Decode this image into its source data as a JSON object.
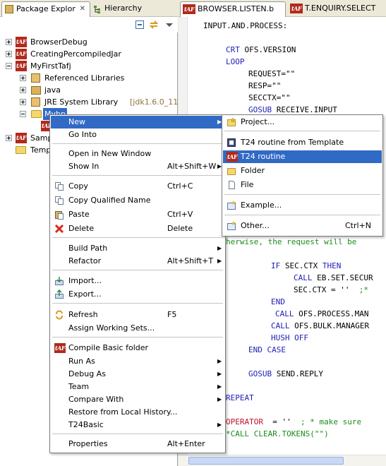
{
  "left_view": {
    "tabs": [
      {
        "label": "Package Explor",
        "active": true,
        "icon": "package-explorer-icon"
      },
      {
        "label": "Hierarchy",
        "active": false,
        "icon": "hierarchy-icon"
      }
    ],
    "toolbar_icons": [
      "collapse-all-icon",
      "link-with-editor-icon",
      "view-menu-icon"
    ],
    "tree": [
      {
        "label": "BrowserDebug",
        "icon": "taf-icon",
        "expanded": false
      },
      {
        "label": "CreatingPercompiledJar",
        "icon": "taf-icon",
        "expanded": false
      },
      {
        "label": "MyFirstTafj",
        "icon": "taf-icon",
        "expanded": true
      },
      {
        "label": "Referenced Libraries",
        "icon": "jar-icon",
        "expanded": false
      },
      {
        "label": "java",
        "icon": "package-root-icon",
        "expanded": false
      },
      {
        "label": "JRE System Library",
        "suffix": "[jdk1.6.0_11]",
        "icon": "jar-icon",
        "expanded": false
      },
      {
        "label": "Mybp",
        "icon": "folder-icon",
        "expanded": true,
        "selected": true
      },
      {
        "label": "Samp",
        "icon": "taf-icon",
        "expanded": false
      },
      {
        "label": "Temp",
        "icon": "folder-icon",
        "expanded": false
      }
    ]
  },
  "editor": {
    "tabs": [
      {
        "label": "BROWSER.LISTEN.b",
        "active": true
      },
      {
        "label": "T.ENQUIRY.SELECT",
        "active": false
      }
    ],
    "lines": {
      "l1": "INPUT.AND.PROCESS:",
      "l2_kw": "CRT",
      "l2_rest": " OFS.VERSION",
      "l3": "LOOP",
      "l4": "REQUEST=\"\"",
      "l5": "RESP=\"\"",
      "l6": "SECCTX=\"\"",
      "l7_kw": "GOSUB",
      "l7_rest": " RECEIVE.INPUT",
      "l8": "herwise, the request will be",
      "l9_kw1": "IF",
      "l9_mid": " SEC.CTX ",
      "l9_kw2": "THEN",
      "l10_kw": "CALL",
      "l10_rest": " EB.SET.SECUR",
      "l11": "SEC.CTX = ''",
      "l11_cm": "  ;*",
      "l12": "END",
      "l13_kw": "CALL",
      "l13_rest": " OFS.PROCESS.MAN",
      "l14_kw": "CALL",
      "l14_rest": " OFS.BULK.MANAGER",
      "l15_kw": "HUSH",
      "l15_rest": " OFF",
      "l16": "END CASE",
      "l17_kw": "GOSUB",
      "l17_rest": " SEND.REPLY",
      "l18": "REPEAT",
      "l19_op": "OPERATOR",
      "l19_rest": "  = ''",
      "l19_cm": "  ; * make sure",
      "l20": "*CALL CLEAR.TOKENS(\"\")"
    }
  },
  "context_menu": {
    "items": [
      {
        "label": "New",
        "submenu": true,
        "highlighted": true
      },
      {
        "label": "Go Into"
      },
      {
        "label": "Open in New Window"
      },
      {
        "label": "Show In",
        "shortcut": "Alt+Shift+W",
        "submenu": true
      },
      {
        "label": "Copy",
        "shortcut": "Ctrl+C",
        "icon": "copy-icon"
      },
      {
        "label": "Copy Qualified Name",
        "icon": "copy-icon"
      },
      {
        "label": "Paste",
        "shortcut": "Ctrl+V",
        "icon": "paste-icon"
      },
      {
        "label": "Delete",
        "shortcut": "Delete",
        "icon": "delete-icon"
      },
      {
        "label": "Build Path",
        "submenu": true
      },
      {
        "label": "Refactor",
        "shortcut": "Alt+Shift+T",
        "submenu": true
      },
      {
        "label": "Import...",
        "icon": "import-icon"
      },
      {
        "label": "Export...",
        "icon": "export-icon"
      },
      {
        "label": "Refresh",
        "shortcut": "F5",
        "icon": "refresh-icon"
      },
      {
        "label": "Assign Working Sets..."
      },
      {
        "label": "Compile Basic folder",
        "icon": "taf-icon"
      },
      {
        "label": "Run As",
        "submenu": true
      },
      {
        "label": "Debug As",
        "submenu": true
      },
      {
        "label": "Team",
        "submenu": true
      },
      {
        "label": "Compare With",
        "submenu": true
      },
      {
        "label": "Restore from Local History..."
      },
      {
        "label": "T24Basic",
        "submenu": true
      },
      {
        "label": "Properties",
        "shortcut": "Alt+Enter"
      }
    ]
  },
  "submenu": {
    "items": [
      {
        "label": "Project...",
        "icon": "new-project-icon"
      },
      {
        "label": "T24 routine from Template",
        "icon": "template-icon"
      },
      {
        "label": "T24 routine",
        "icon": "taf-icon",
        "highlighted": true
      },
      {
        "label": "Folder",
        "icon": "folder-icon"
      },
      {
        "label": "File",
        "icon": "file-icon"
      },
      {
        "label": "Example...",
        "icon": "example-icon"
      },
      {
        "label": "Other...",
        "shortcut": "Ctrl+N",
        "icon": "other-wizard-icon"
      }
    ]
  },
  "icon_text": {
    "taf": "tAF"
  },
  "colors": {
    "selection": "#316ac5",
    "taf_brand": "#b02b1b",
    "keyword": "#1e1eb4",
    "comment": "#1c8c1c"
  }
}
